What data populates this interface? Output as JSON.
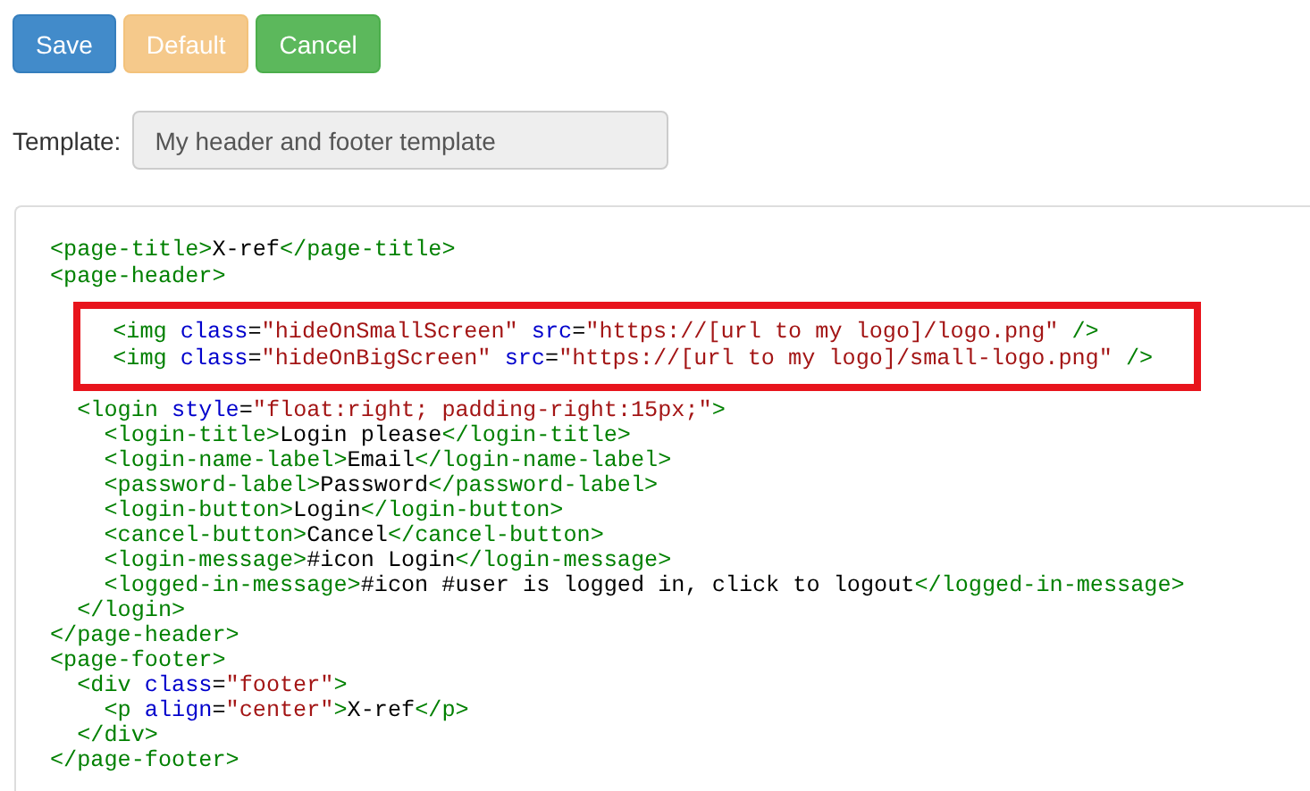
{
  "buttons": [
    {
      "label": "Save",
      "kind": "primary",
      "disabled": false
    },
    {
      "label": "Default",
      "kind": "warning",
      "disabled": true
    },
    {
      "label": "Cancel",
      "kind": "success",
      "disabled": false
    }
  ],
  "template": {
    "label": "Template:",
    "value": "My header and footer template"
  },
  "code": {
    "blocks": [
      {
        "highlighted": false,
        "lines": [
          [
            {
              "kind": "tag",
              "text": "<page-title>"
            },
            {
              "kind": "text",
              "text": "X-ref"
            },
            {
              "kind": "tag",
              "text": "</page-title>"
            }
          ],
          [
            {
              "kind": "tag",
              "text": "<page-header>"
            }
          ]
        ]
      },
      {
        "highlighted": true,
        "lines": [
          [
            {
              "kind": "tag",
              "text": "  <img "
            },
            {
              "kind": "attr",
              "text": "class"
            },
            {
              "kind": "text",
              "text": "="
            },
            {
              "kind": "value",
              "text": "\"hideOnSmallScreen\" "
            },
            {
              "kind": "attr",
              "text": "src"
            },
            {
              "kind": "text",
              "text": "="
            },
            {
              "kind": "value",
              "text": "\"https://[url to my logo]/logo.png\""
            },
            {
              "kind": "tag",
              "text": " />"
            }
          ],
          [
            {
              "kind": "tag",
              "text": "  <img "
            },
            {
              "kind": "attr",
              "text": "class"
            },
            {
              "kind": "text",
              "text": "="
            },
            {
              "kind": "value",
              "text": "\"hideOnBigScreen\" "
            },
            {
              "kind": "attr",
              "text": "src"
            },
            {
              "kind": "text",
              "text": "="
            },
            {
              "kind": "value",
              "text": "\"https://[url to my logo]/small-logo.png\""
            },
            {
              "kind": "tag",
              "text": " />"
            }
          ]
        ]
      },
      {
        "highlighted": false,
        "lines": [
          [
            {
              "kind": "tag",
              "text": "  <login "
            },
            {
              "kind": "attr",
              "text": "style"
            },
            {
              "kind": "text",
              "text": "="
            },
            {
              "kind": "value",
              "text": "\"float:right; padding-right:15px;\""
            },
            {
              "kind": "tag",
              "text": ">"
            }
          ],
          [
            {
              "kind": "tag",
              "text": "    <login-title>"
            },
            {
              "kind": "text",
              "text": "Login please"
            },
            {
              "kind": "tag",
              "text": "</login-title>"
            }
          ],
          [
            {
              "kind": "tag",
              "text": "    <login-name-label>"
            },
            {
              "kind": "text",
              "text": "Email"
            },
            {
              "kind": "tag",
              "text": "</login-name-label>"
            }
          ],
          [
            {
              "kind": "tag",
              "text": "    <password-label>"
            },
            {
              "kind": "text",
              "text": "Password"
            },
            {
              "kind": "tag",
              "text": "</password-label>"
            }
          ],
          [
            {
              "kind": "tag",
              "text": "    <login-button>"
            },
            {
              "kind": "text",
              "text": "Login"
            },
            {
              "kind": "tag",
              "text": "</login-button>"
            }
          ],
          [
            {
              "kind": "tag",
              "text": "    <cancel-button>"
            },
            {
              "kind": "text",
              "text": "Cancel"
            },
            {
              "kind": "tag",
              "text": "</cancel-button>"
            }
          ],
          [
            {
              "kind": "tag",
              "text": "    <login-message>"
            },
            {
              "kind": "text",
              "text": "#icon Login"
            },
            {
              "kind": "tag",
              "text": "</login-message>"
            }
          ],
          [
            {
              "kind": "tag",
              "text": "    <logged-in-message>"
            },
            {
              "kind": "text",
              "text": "#icon #user is logged in, click to logout"
            },
            {
              "kind": "tag",
              "text": "</logged-in-message>"
            }
          ],
          [
            {
              "kind": "tag",
              "text": "  </login>"
            }
          ],
          [
            {
              "kind": "tag",
              "text": "</page-header>"
            }
          ],
          [
            {
              "kind": "tag",
              "text": "<page-footer>"
            }
          ],
          [
            {
              "kind": "tag",
              "text": "  <div "
            },
            {
              "kind": "attr",
              "text": "class"
            },
            {
              "kind": "text",
              "text": "="
            },
            {
              "kind": "value",
              "text": "\"footer\""
            },
            {
              "kind": "tag",
              "text": ">"
            }
          ],
          [
            {
              "kind": "tag",
              "text": "    <p "
            },
            {
              "kind": "attr",
              "text": "align"
            },
            {
              "kind": "text",
              "text": "="
            },
            {
              "kind": "value",
              "text": "\"center\""
            },
            {
              "kind": "tag",
              "text": ">"
            },
            {
              "kind": "text",
              "text": "X-ref"
            },
            {
              "kind": "tag",
              "text": "</p>"
            }
          ],
          [
            {
              "kind": "tag",
              "text": "  </div>"
            }
          ],
          [
            {
              "kind": "tag",
              "text": "</page-footer>"
            }
          ]
        ]
      }
    ]
  }
}
